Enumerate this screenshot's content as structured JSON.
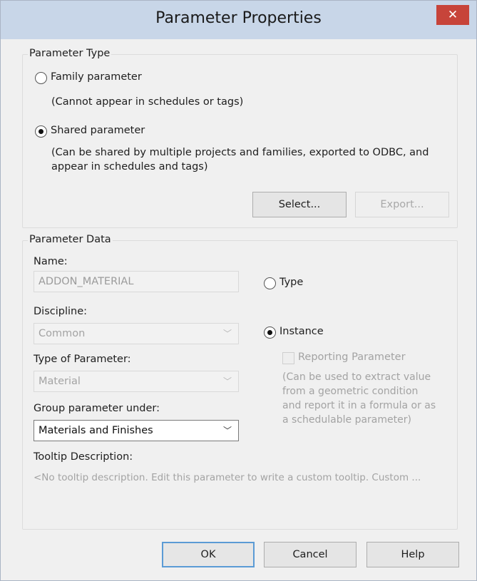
{
  "window": {
    "title": "Parameter Properties",
    "close_label": "✕"
  },
  "parameter_type": {
    "title": "Parameter Type",
    "family_label": "Family parameter",
    "family_note": "(Cannot appear in schedules or tags)",
    "shared_label": "Shared parameter",
    "shared_note_line1": "(Can be shared by multiple projects and families, exported to ODBC, and",
    "shared_note_line2": "appear in schedules and tags)",
    "selected": "shared",
    "select_button": "Select...",
    "export_button": "Export..."
  },
  "parameter_data": {
    "title": "Parameter Data",
    "name_label": "Name:",
    "name_value": "ADDON_MATERIAL",
    "discipline_label": "Discipline:",
    "discipline_value": "Common",
    "type_of_parameter_label": "Type of Parameter:",
    "type_of_parameter_value": "Material",
    "group_label": "Group parameter under:",
    "group_value": "Materials and Finishes",
    "type_radio_label": "Type",
    "instance_radio_label": "Instance",
    "scope_selected": "instance",
    "reporting_label": "Reporting Parameter",
    "reporting_checked": false,
    "reporting_note_line1": "(Can be used to extract value",
    "reporting_note_line2": "from a geometric condition",
    "reporting_note_line3": "and report it in a formula or as",
    "reporting_note_line4": "a schedulable parameter)",
    "tooltip_label": "Tooltip Description:",
    "tooltip_value": "<No tooltip description. Edit this parameter to write a custom tooltip. Custom ..."
  },
  "buttons": {
    "ok": "OK",
    "cancel": "Cancel",
    "help": "Help"
  },
  "icons": {
    "close": "close-icon",
    "dropdown": "chevron-down-icon"
  },
  "colors": {
    "titlebar": "#c8d6e8",
    "close_button": "#c7443a",
    "default_button_border": "#5b9bd5"
  }
}
